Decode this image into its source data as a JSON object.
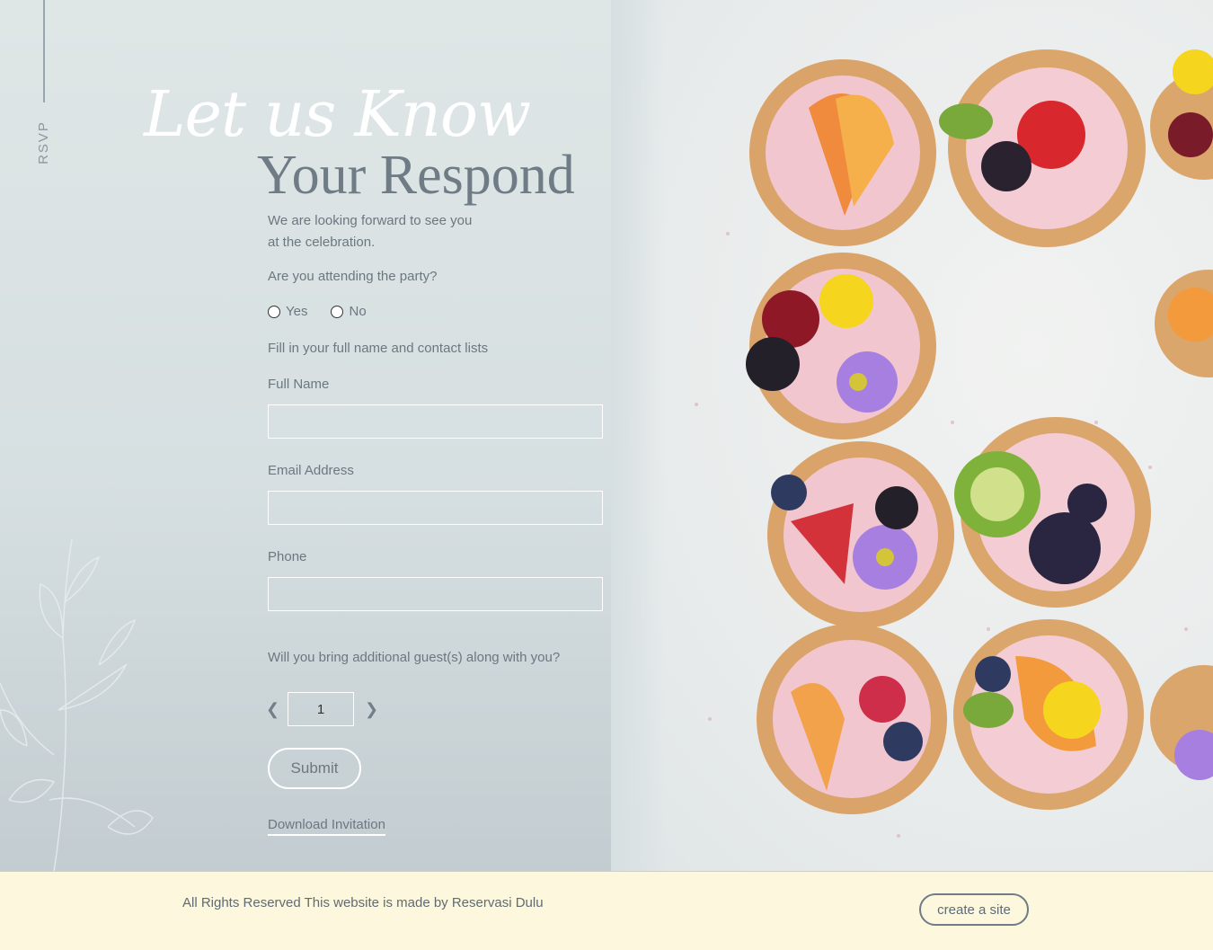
{
  "sidebar": {
    "label": "RSVP"
  },
  "hero": {
    "script_title": "Let us Know",
    "title": "Your Respond",
    "intro_line1": "We are looking forward to see you",
    "intro_line2": "at the celebration."
  },
  "form": {
    "attending_question": "Are you attending the party?",
    "yes_label": "Yes",
    "no_label": "No",
    "fill_instruction": "Fill in your full name and contact lists",
    "full_name_label": "Full Name",
    "full_name_value": "",
    "email_label": "Email Address",
    "email_value": "",
    "phone_label": "Phone",
    "phone_value": "",
    "guests_question": "Will you bring additional guest(s) along with you?",
    "guests_value": "1",
    "submit_label": "Submit",
    "download_label": "Download Invitation"
  },
  "footer": {
    "text": "All Rights Reserved This website is made by Reservasi Dulu",
    "cta_label": "create a site"
  },
  "colors": {
    "background": "#d6dfe1",
    "text": "#6b7880",
    "title": "#6f7c86",
    "footer_bg": "#fdf8dd"
  }
}
